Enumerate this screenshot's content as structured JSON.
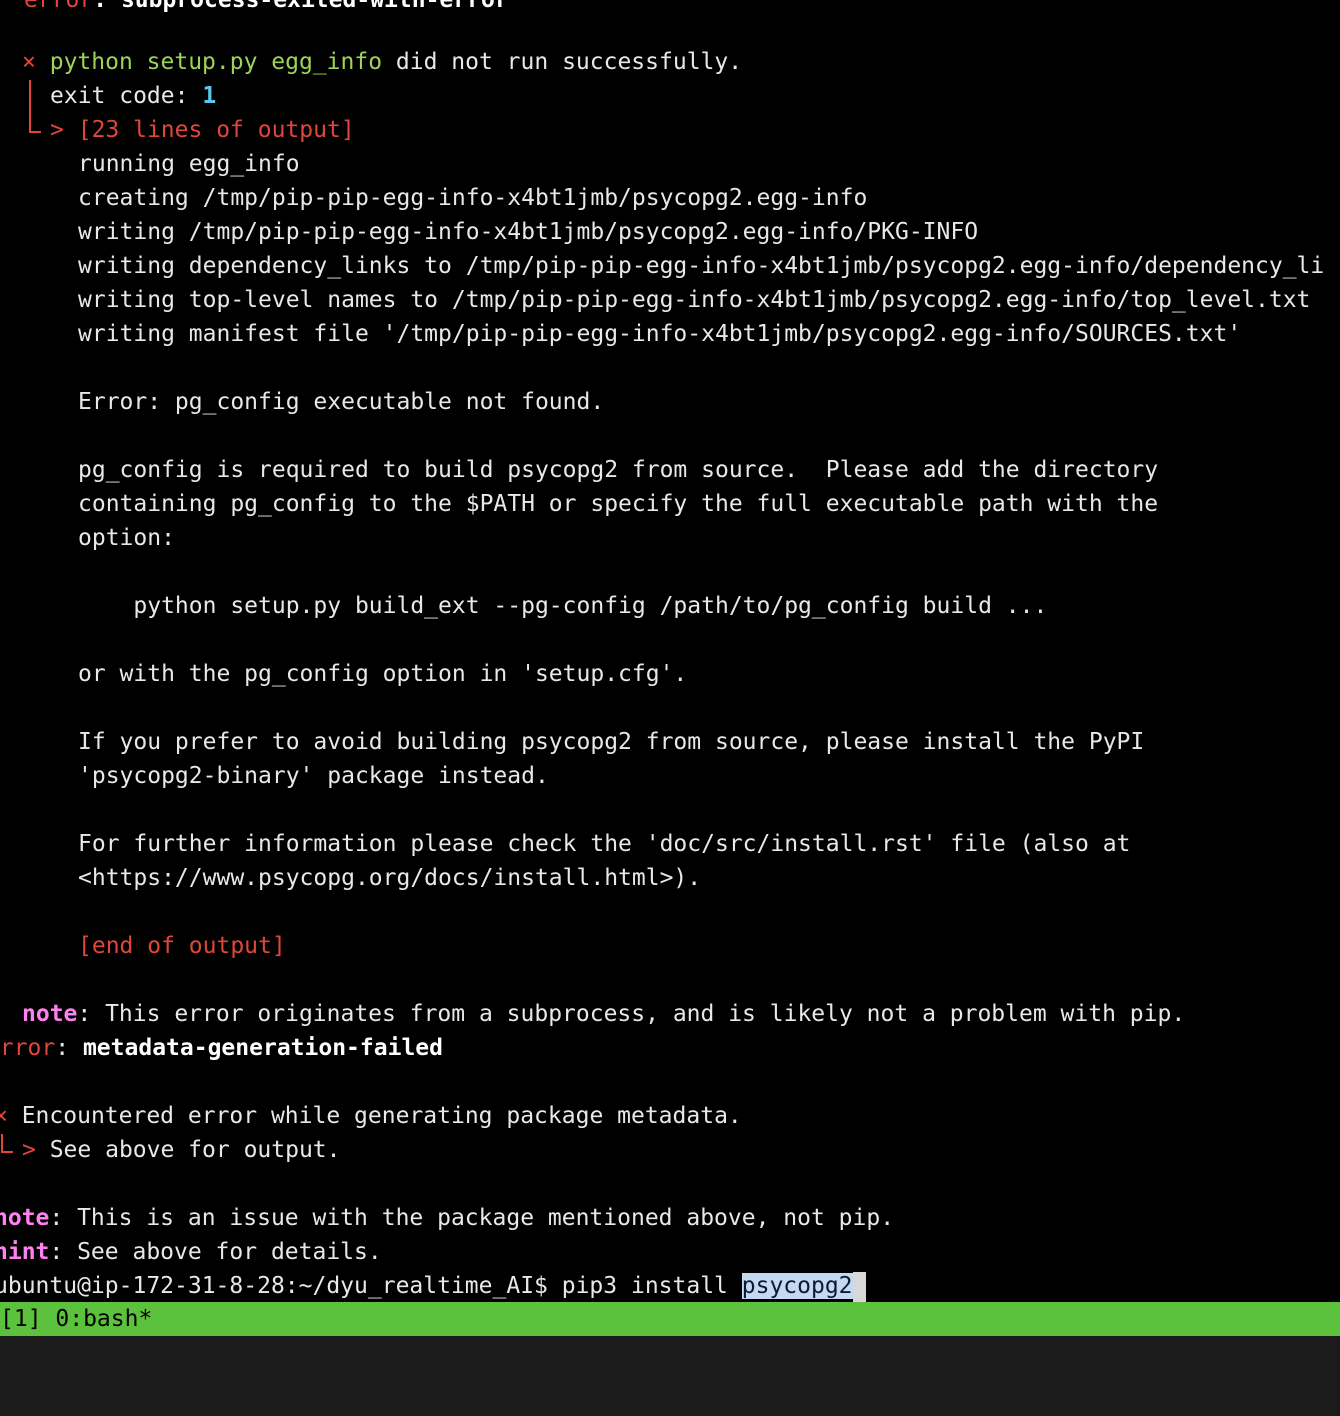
{
  "terminal": {
    "top_partial": {
      "label": "error",
      "text": ": subprocess-exited-with-error"
    },
    "header": {
      "marker": "×",
      "command": "python setup.py egg_info",
      "result": " did not run successfully.",
      "exit_label": "exit code: ",
      "exit_code": "1",
      "arrow": ">",
      "lines_count": "[23 lines of output]"
    },
    "output_lines": [
      "running egg_info",
      "creating /tmp/pip-pip-egg-info-x4bt1jmb/psycopg2.egg-info",
      "writing /tmp/pip-pip-egg-info-x4bt1jmb/psycopg2.egg-info/PKG-INFO",
      "writing dependency_links to /tmp/pip-pip-egg-info-x4bt1jmb/psycopg2.egg-info/dependency_li",
      "writing top-level names to /tmp/pip-pip-egg-info-x4bt1jmb/psycopg2.egg-info/top_level.txt",
      "writing manifest file '/tmp/pip-pip-egg-info-x4bt1jmb/psycopg2.egg-info/SOURCES.txt'",
      "",
      "Error: pg_config executable not found.",
      "",
      "pg_config is required to build psycopg2 from source.  Please add the directory",
      "containing pg_config to the $PATH or specify the full executable path with the",
      "option:",
      "",
      "    python setup.py build_ext --pg-config /path/to/pg_config build ...",
      "",
      "or with the pg_config option in 'setup.cfg'.",
      "",
      "If you prefer to avoid building psycopg2 from source, please install the PyPI",
      "'psycopg2-binary' package instead.",
      "",
      "For further information please check the 'doc/src/install.rst' file (also at",
      "<https://www.psycopg.org/docs/install.html>)."
    ],
    "end_marker": "[end of output]",
    "note1": {
      "label": "note",
      "text": ": This error originates from a subprocess, and is likely not a problem with pip."
    },
    "error2": {
      "label": "error",
      "sep": ": ",
      "text": "metadata-generation-failed"
    },
    "encountered": {
      "marker": "×",
      "text": " Encountered error while generating package metadata.",
      "arrow": ">",
      "sub": " See above for output."
    },
    "note2": {
      "label": "note",
      "text": ": This is an issue with the package mentioned above, not pip."
    },
    "hint": {
      "label": "hint",
      "text": ": See above for details."
    },
    "prompt": {
      "text": "ubuntu@ip-172-31-8-28:~/dyu_realtime_AI$ pip3 install ",
      "selected": "psycopg2"
    }
  },
  "statusbar": {
    "text": "[1] 0:bash*"
  },
  "colors": {
    "error_red": "#e0463a",
    "command_green": "#9ed35a",
    "status_green": "#5cc13d",
    "note_magenta": "#ff80f0",
    "exit_cyan": "#58c8e8"
  }
}
